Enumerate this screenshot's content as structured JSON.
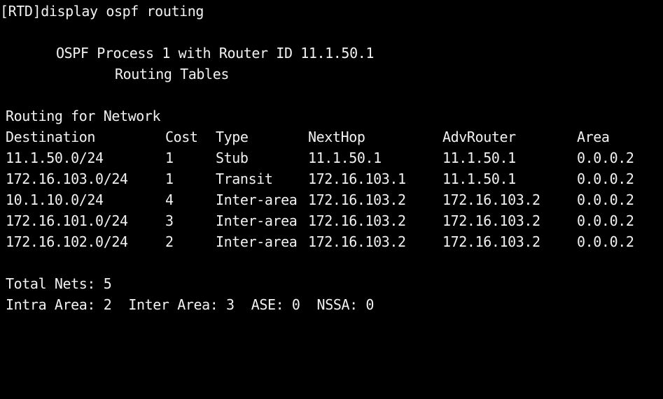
{
  "terminal": {
    "command_line": "[RTD]display ospf routing",
    "process_line": "OSPF Process 1 with Router ID 11.1.50.1",
    "tables_line": "Routing Tables",
    "section_title": "Routing for Network",
    "columns": {
      "destination": "Destination",
      "cost": "Cost",
      "type": "Type",
      "nexthop": "NextHop",
      "advrouter": "AdvRouter",
      "area": "Area"
    },
    "rows": [
      {
        "destination": "11.1.50.0/24",
        "cost": "1",
        "type": "Stub",
        "nexthop": "11.1.50.1",
        "advrouter": "11.1.50.1",
        "area": "0.0.0.2"
      },
      {
        "destination": "172.16.103.0/24",
        "cost": "1",
        "type": "Transit",
        "nexthop": "172.16.103.1",
        "advrouter": "11.1.50.1",
        "area": "0.0.0.2"
      },
      {
        "destination": "10.1.10.0/24",
        "cost": "4",
        "type": "Inter-area",
        "nexthop": "172.16.103.2",
        "advrouter": "172.16.103.2",
        "area": "0.0.0.2"
      },
      {
        "destination": "172.16.101.0/24",
        "cost": "3",
        "type": "Inter-area",
        "nexthop": "172.16.103.2",
        "advrouter": "172.16.103.2",
        "area": "0.0.0.2"
      },
      {
        "destination": "172.16.102.0/24",
        "cost": "2",
        "type": "Inter-area",
        "nexthop": "172.16.103.2",
        "advrouter": "172.16.103.2",
        "area": "0.0.0.2"
      }
    ],
    "total_nets": "Total Nets: 5",
    "summary": {
      "intra": "Intra Area: 2",
      "inter": "Inter Area: 3",
      "ase": "ASE: 0",
      "nssa": "NSSA: 0"
    }
  },
  "colors": {
    "background": "#000000",
    "foreground": "#f2f2f2"
  }
}
